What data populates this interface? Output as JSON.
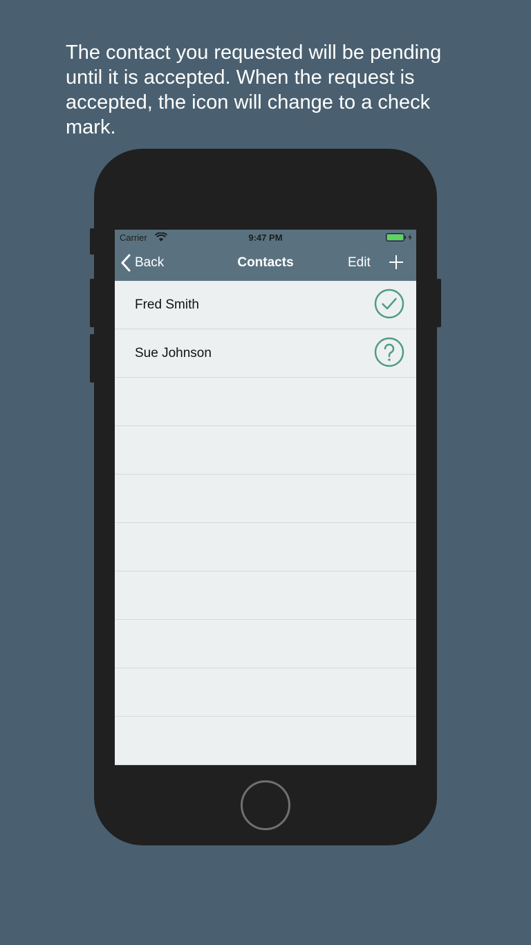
{
  "caption": "The contact you requested will be pending until it is accepted. When the request is accepted, the icon will change to a check mark.",
  "status_bar": {
    "carrier": "Carrier",
    "time": "9:47 PM"
  },
  "nav": {
    "back_label": "Back",
    "title": "Contacts",
    "edit_label": "Edit"
  },
  "contacts": [
    {
      "name": "Fred Smith",
      "status_icon": "check-circle-icon"
    },
    {
      "name": "Sue Johnson",
      "status_icon": "question-circle-icon"
    }
  ],
  "colors": {
    "background": "#4a6070",
    "nav_bar": "#5a7280",
    "list_background": "#edf0f1",
    "status_icon": "#4f9c85",
    "battery": "#5cd65c"
  }
}
